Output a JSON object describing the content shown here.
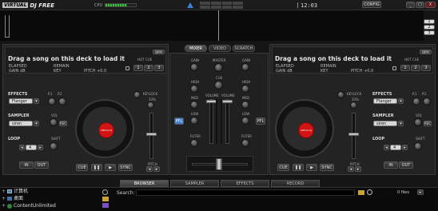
{
  "titlebar": {
    "logo_brand": "VIRTUAL",
    "logo_product": "DJ FREE",
    "cpu_label": "CPU",
    "clock": "12:03",
    "config_label": "CONFIG",
    "win_min": "_",
    "win_max": "□",
    "win_close": "X"
  },
  "side_buttons": [
    "1",
    "2",
    "3"
  ],
  "decks": [
    {
      "title": "Drag a song on this deck to load it",
      "bpm_label": "BPM",
      "elapsed_label": "ELAPSED",
      "remain_label": "REMAIN",
      "gain_label": "GAIN dB",
      "key_label": "KEY",
      "pitch_label": "PITCH +0.0",
      "hotcue_label": "HOT CUE",
      "hotcue_buttons": [
        "1",
        "2",
        "3"
      ],
      "effects_label": "EFFECTS",
      "effect_value": "Flanger",
      "p1_label": "P.1",
      "p2_label": "P.2",
      "sampler_label": "SAMPLER",
      "sampler_value": "siren",
      "vol_label": "VOL",
      "rec_label": "REC",
      "loop_label": "LOOP",
      "loop_value": "4",
      "shift_label": "SHIFT",
      "in_label": "IN",
      "out_label": "OUT",
      "keylock_label": "KEYLOCK",
      "keylock_value": "33%",
      "pitch_slider_label": "PITCH",
      "cue_label": "CUE",
      "play_label": "▶",
      "pause_label": "❚❚",
      "sync_label": "SYNC",
      "platter_label": "VIRTUAL DJ"
    },
    {
      "title": "Drag a song on this deck to load it",
      "bpm_label": "BPM",
      "elapsed_label": "ELAPSED",
      "remain_label": "REMAIN",
      "gain_label": "GAIN dB",
      "key_label": "KEY",
      "pitch_label": "PITCH +0.0",
      "hotcue_label": "HOT CUE",
      "hotcue_buttons": [
        "1",
        "2",
        "3"
      ],
      "effects_label": "EFFECTS",
      "effect_value": "Flanger",
      "p1_label": "P.1",
      "p2_label": "P.2",
      "sampler_label": "SAMPLER",
      "sampler_value": "siren",
      "vol_label": "VOL",
      "rec_label": "REC",
      "loop_label": "LOOP",
      "loop_value": "4",
      "shift_label": "SHIFT",
      "in_label": "IN",
      "out_label": "OUT",
      "keylock_label": "KEYLOCK",
      "keylock_value": "33%",
      "pitch_slider_label": "PITCH",
      "cue_label": "CUE",
      "play_label": "▶",
      "pause_label": "❚❚",
      "sync_label": "SYNC",
      "platter_label": "VIRTUAL DJ"
    }
  ],
  "mixer": {
    "tabs": [
      "MIXER",
      "VIDEO",
      "SCRATCH"
    ],
    "active_tab": "MIXER",
    "gain_label": "GAIN",
    "master_label": "MASTER",
    "cue_label": "CUE",
    "high_label": "HIGH",
    "mid_label": "MED",
    "low_label": "LOW",
    "volume_label": "VOLUME",
    "filter_label": "FILTER",
    "pfl_label": "PFL"
  },
  "browser": {
    "tabs": [
      "BROWSER",
      "SAMPLER",
      "EFFECTS",
      "RECORD"
    ],
    "active_tab": "BROWSER",
    "search_label": "Search:",
    "files_count": "0 files",
    "tree": [
      "计算机",
      "桌面",
      "ContentUnlimited"
    ]
  },
  "colors": {
    "accent_red": "#d21414",
    "titlebar_bg": "#1b1b1b",
    "cpu_green": "#3fbf3f",
    "pfl_blue": "#3d7fd6"
  },
  "icons": {
    "minimize": "minimize-icon",
    "close": "close-icon",
    "lock": "lock-icon",
    "folder": "folder-icon"
  }
}
